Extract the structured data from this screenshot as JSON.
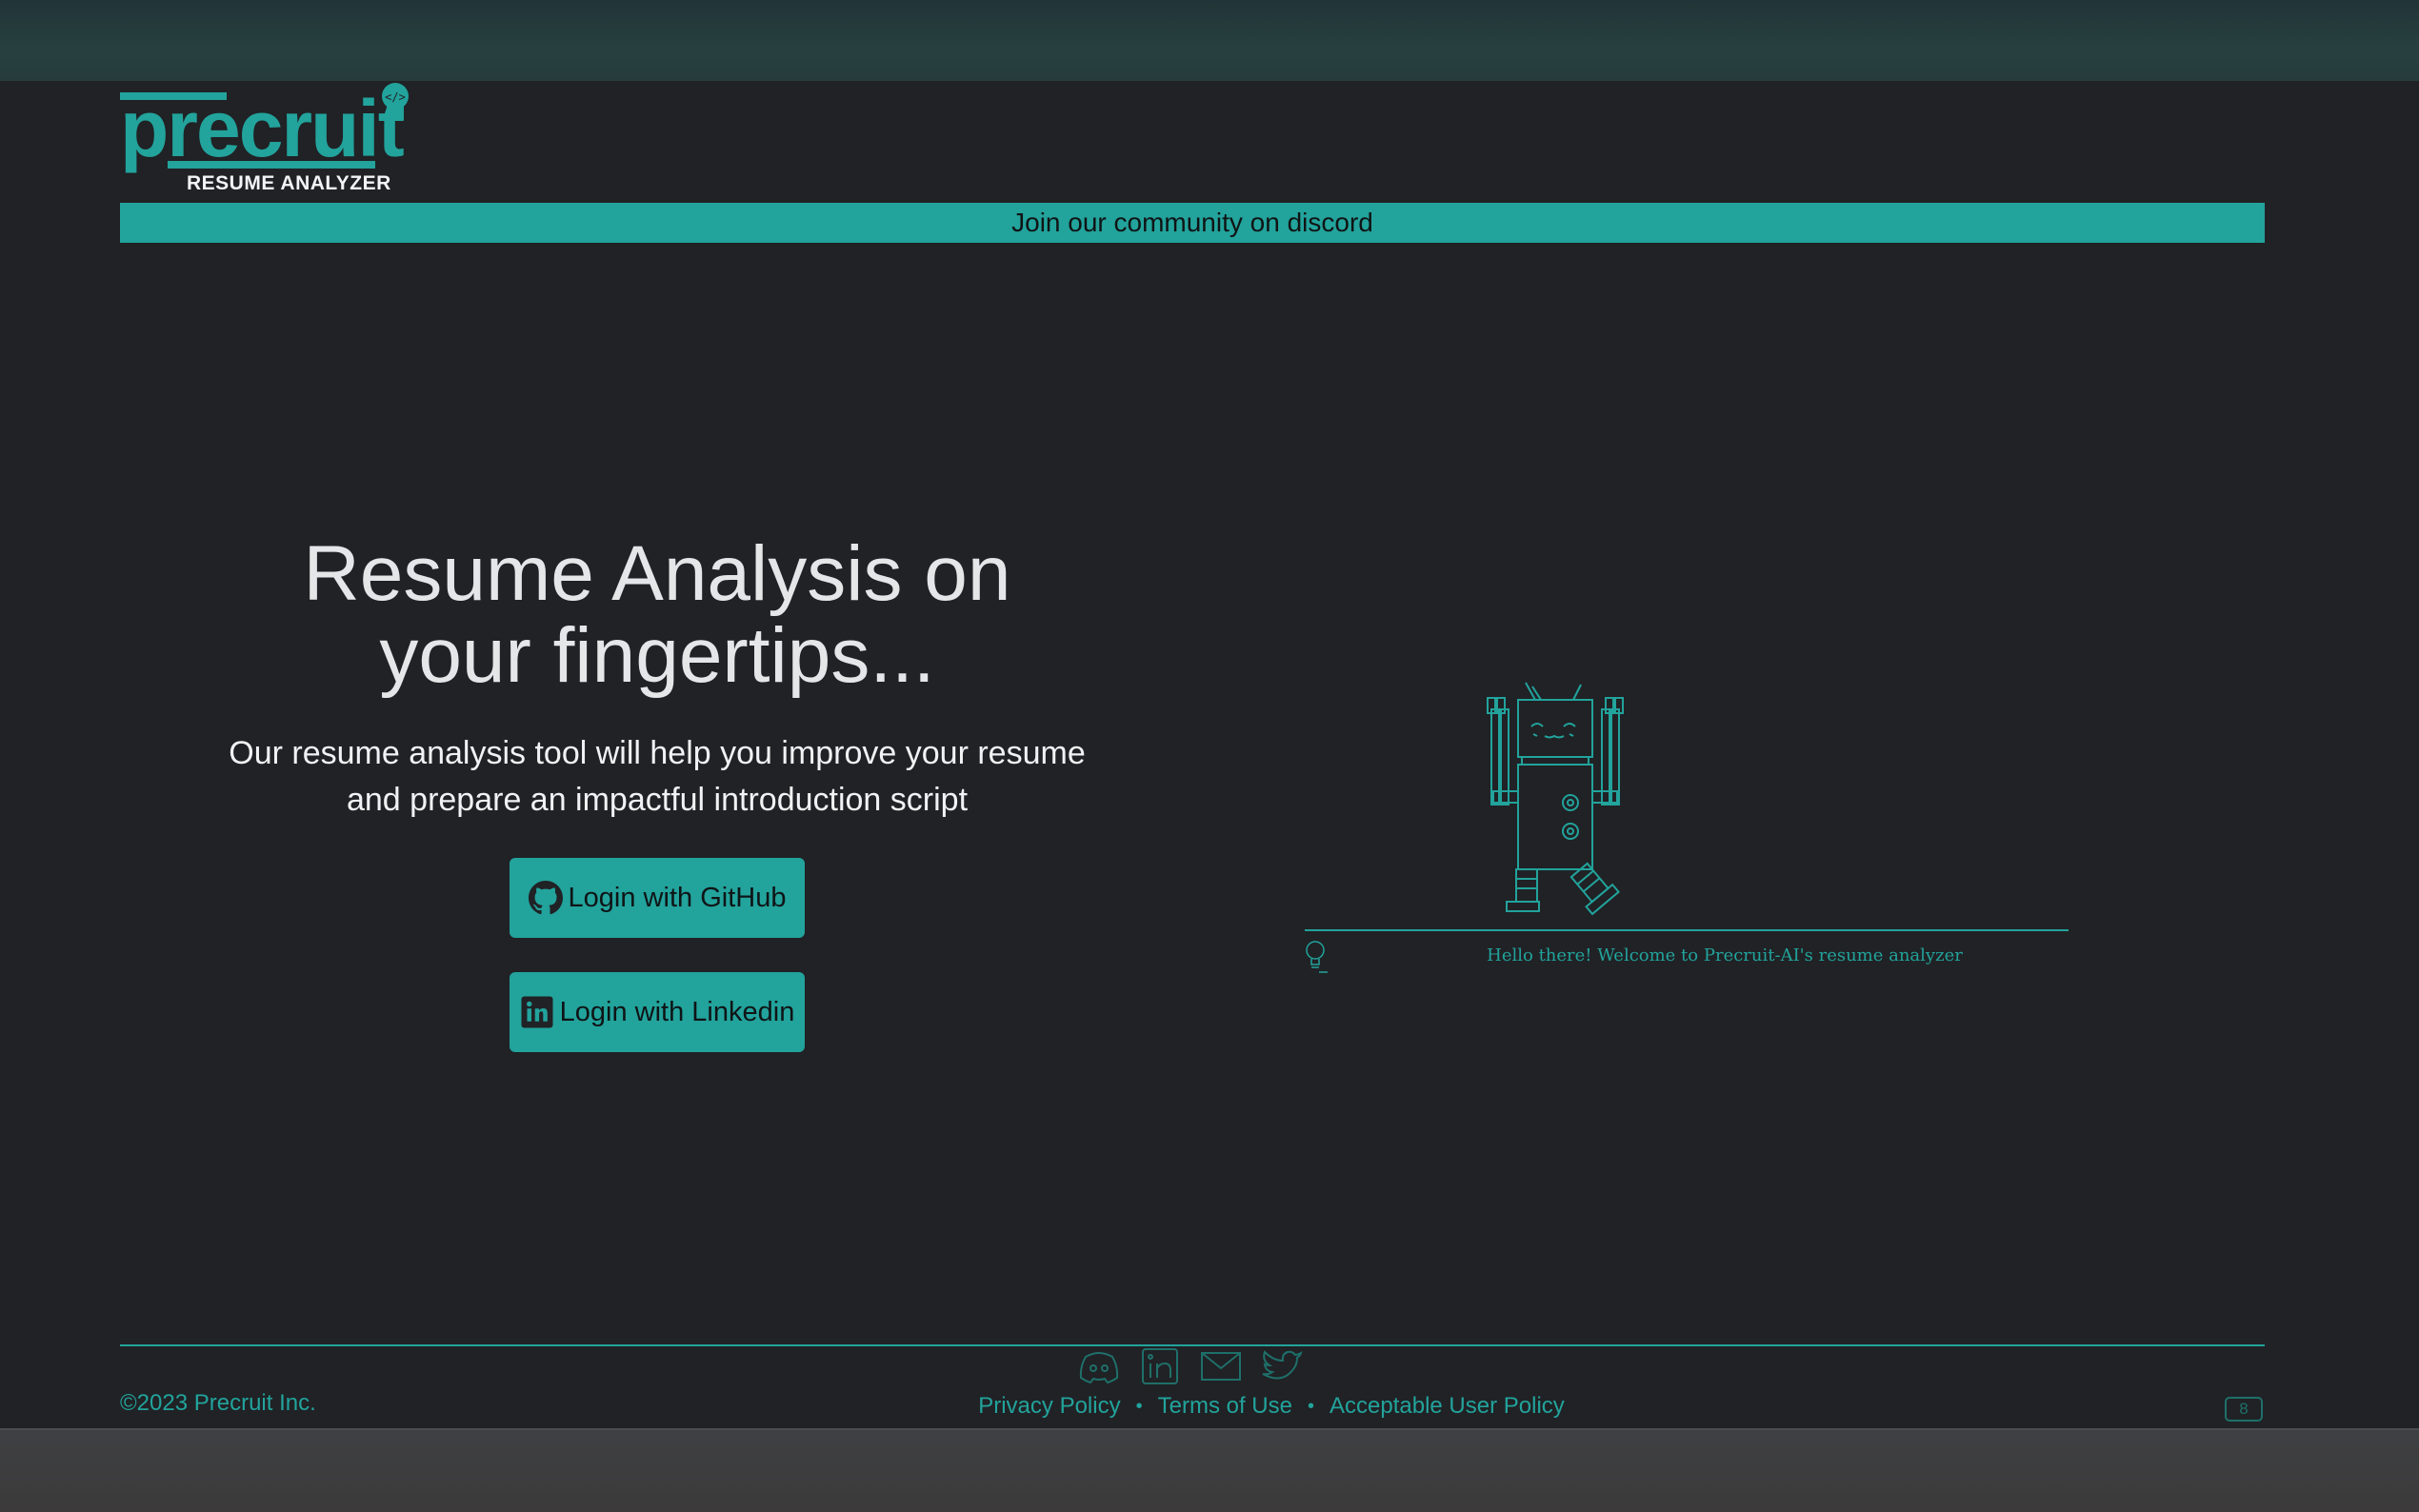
{
  "logo": {
    "word": "precruit",
    "subtitle": "RESUME ANALYZER",
    "badge_icon": "code-badge-icon"
  },
  "banner": {
    "label": "Join our community on discord"
  },
  "hero": {
    "title_line1": "Resume Analysis on",
    "title_line2": "your fingertips...",
    "subtitle_line1": "Our resume analysis tool will help you improve your resume",
    "subtitle_line2": "and prepare an impactful introduction script"
  },
  "buttons": {
    "github": {
      "label": "Login with GitHub",
      "icon": "github-icon"
    },
    "linkedin": {
      "label": "Login with Linkedin",
      "icon": "linkedin-icon"
    }
  },
  "robot": {
    "caption": "Hello there! Welcome to Precruit-AI's resume analyzer"
  },
  "footer": {
    "copyright": "©2023 Precruit Inc.",
    "links": [
      "Privacy Policy",
      "Terms of Use",
      "Acceptable User Policy"
    ],
    "separator": "•",
    "social_icons": [
      "discord-icon",
      "linkedin-icon",
      "mail-icon",
      "twitter-icon"
    ],
    "shortcut_badge": "8"
  },
  "colors": {
    "accent": "#22a39c",
    "background": "#202225",
    "text": "#e4e6e8"
  }
}
